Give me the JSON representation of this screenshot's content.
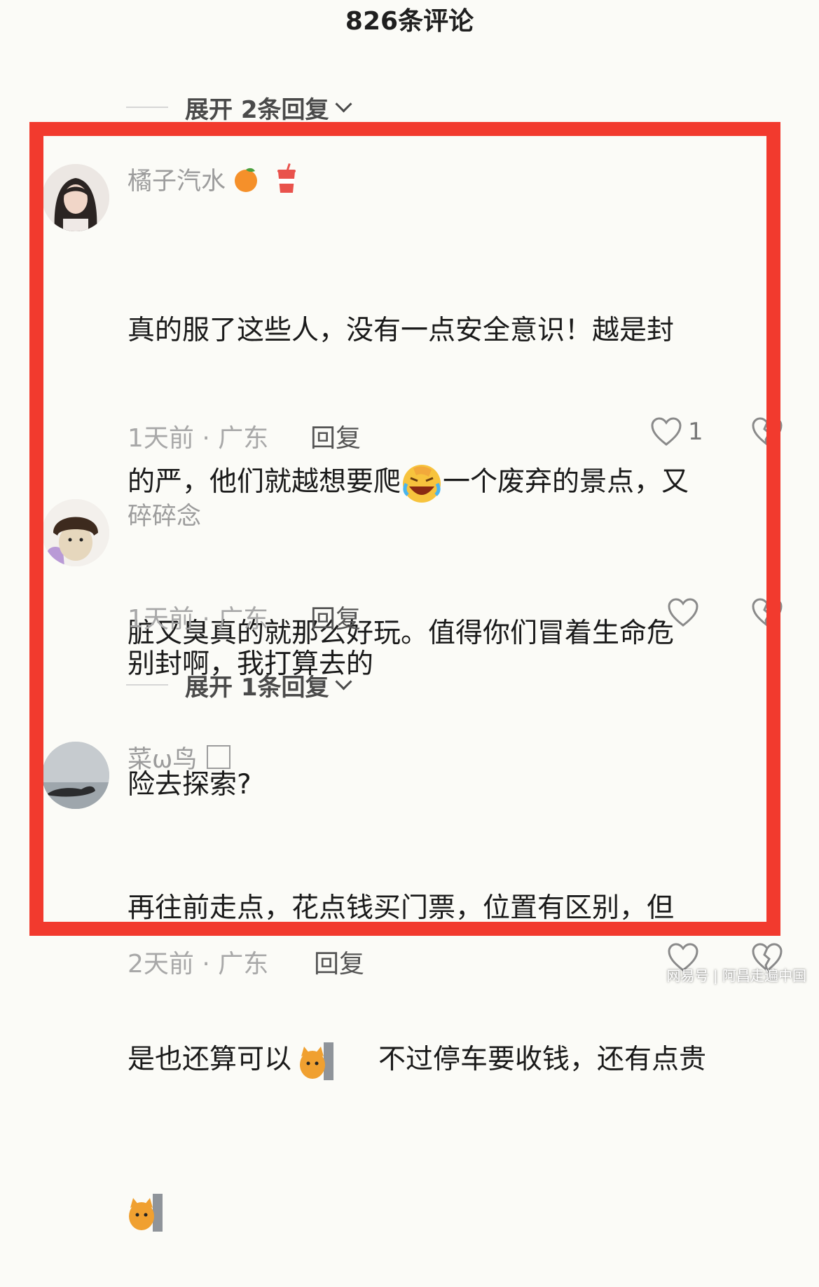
{
  "header": {
    "title": "826条评论"
  },
  "expand_top": {
    "label": "展开 2条回复"
  },
  "comments": [
    {
      "username": "橘子汽水",
      "text_lines": [
        "真的服了这些人，没有一点安全意识！越是封",
        "的严，他们就越想要爬",
        "一个废弃的景点，又",
        "脏又臭真的就那么好玩。值得你们冒着生命危",
        "险去探索?"
      ],
      "meta": "1天前 · 广东",
      "reply": "回复",
      "likes": "1"
    },
    {
      "username": "碎碎念",
      "text_lines": [
        "别封啊，我打算去的"
      ],
      "meta": "1天前 · 广东",
      "reply": "回复",
      "likes": ""
    },
    {
      "username": "菜ω鸟",
      "text_lines": [
        "再往前走点，花点钱买门票，位置有区别，但",
        "是也还算可以",
        "不过停车要收钱，还有点贵"
      ],
      "meta": "2天前 · 广东",
      "reply": "回复",
      "likes": ""
    }
  ],
  "expand_mid": {
    "label": "展开 1条回复"
  },
  "watermark": "网易号 | 阿昌走遍中国",
  "colors": {
    "highlight_box": "#f23a2e",
    "background": "#fbfbf7"
  }
}
